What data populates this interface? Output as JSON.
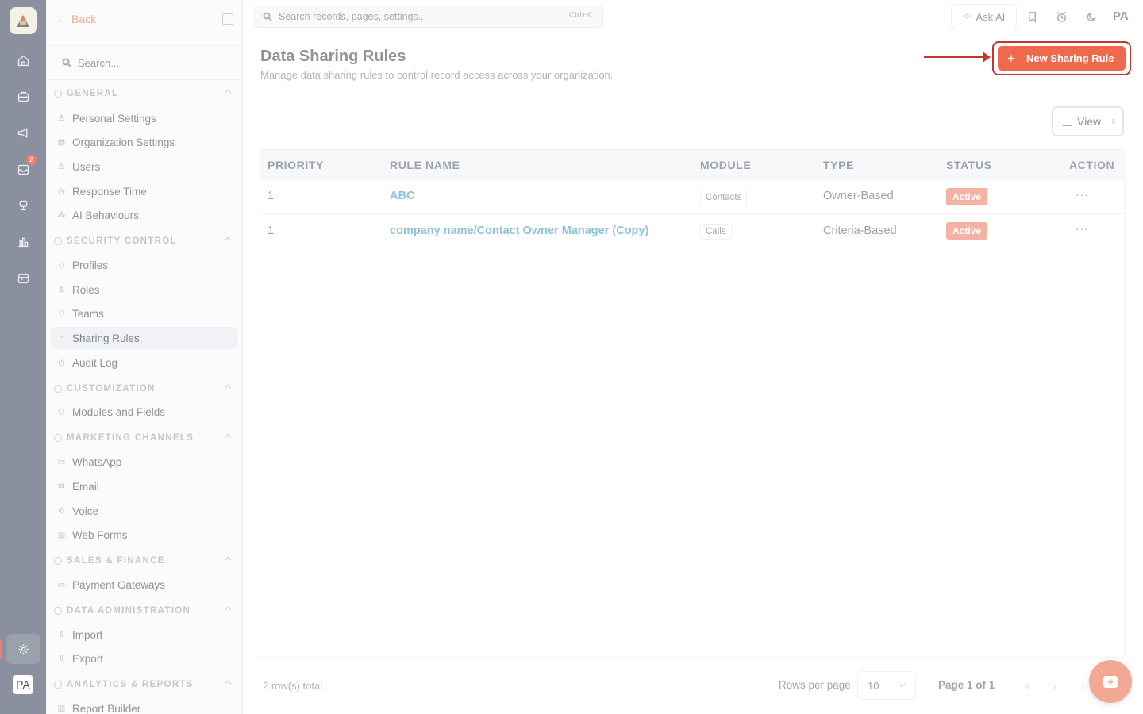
{
  "rail": {
    "badge_count": "2",
    "avatar_initials": "PA",
    "icons": [
      "home-icon",
      "briefcase-icon",
      "megaphone-icon",
      "inbox-icon",
      "chat-bot-icon",
      "bar-chart-icon",
      "calendar-icon",
      "gear-icon"
    ]
  },
  "sidebar": {
    "back_label": "Back",
    "search_placeholder": "Search...",
    "sections": [
      {
        "title": "GENERAL",
        "items": [
          "Personal Settings",
          "Organization Settings",
          "Users",
          "Response Time",
          "AI Behaviours"
        ]
      },
      {
        "title": "SECURITY CONTROL",
        "items": [
          "Profiles",
          "Roles",
          "Teams",
          "Sharing Rules",
          "Audit Log"
        ]
      },
      {
        "title": "CUSTOMIZATION",
        "items": [
          "Modules and Fields"
        ]
      },
      {
        "title": "MARKETING CHANNELS",
        "items": [
          "WhatsApp",
          "Email",
          "Voice",
          "Web Forms"
        ]
      },
      {
        "title": "SALES & FINANCE",
        "items": [
          "Payment Gateways"
        ]
      },
      {
        "title": "DATA ADMINISTRATION",
        "items": [
          "Import",
          "Export"
        ]
      },
      {
        "title": "ANALYTICS & REPORTS",
        "items": [
          "Report Builder"
        ]
      }
    ],
    "active_item": "Sharing Rules"
  },
  "topbar": {
    "search_placeholder": "Search records, pages, settings...",
    "search_shortcut": "Ctrl+K",
    "ask_ai_label": "Ask AI",
    "user_initials": "PA"
  },
  "page": {
    "title": "Data Sharing Rules",
    "subtitle": "Manage data sharing rules to control record access across your organization.",
    "new_button_label": "New Sharing Rule",
    "view_button_label": "View"
  },
  "table": {
    "columns": [
      "PRIORITY",
      "RULE NAME",
      "MODULE",
      "TYPE",
      "STATUS",
      "ACTION"
    ],
    "rows": [
      {
        "priority": "1",
        "rule_name": "ABC",
        "module": "Contacts",
        "type": "Owner-Based",
        "status": "Active",
        "action": "···"
      },
      {
        "priority": "1",
        "rule_name": "company name/Contact Owner Manager (Copy)",
        "module": "Calls",
        "type": "Criteria-Based",
        "status": "Active",
        "action": "···"
      }
    ]
  },
  "footer": {
    "total_text": "2 row(s) total.",
    "rows_per_page_label": "Rows per page",
    "rows_per_page_value": "10",
    "page_info": "Page 1 of 1",
    "first_glyph": "«",
    "prev_glyph": "‹",
    "next_glyph": "›"
  },
  "colors": {
    "accent": "#ef6a4c",
    "annotation_red": "#c0392b",
    "link": "#8ec3dc",
    "status_active": "#f3b2a3"
  }
}
